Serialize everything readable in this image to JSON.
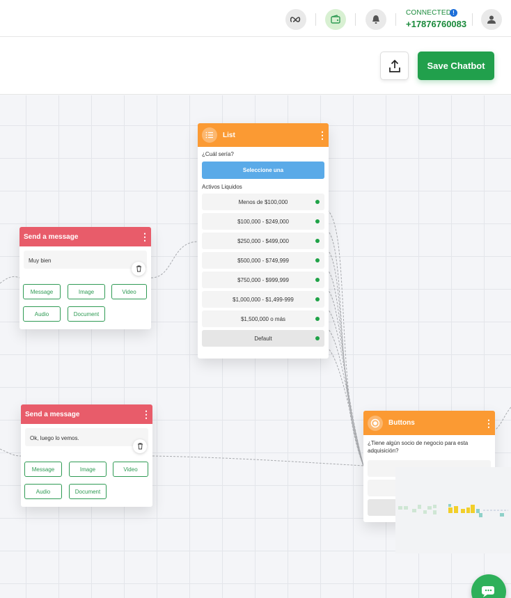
{
  "topbar": {
    "icons": [
      "meta-icon",
      "wallet-icon",
      "bell-icon",
      "user-icon"
    ],
    "connection_status": "CONNECTED",
    "info_mark": "!",
    "phone": "+17876760083"
  },
  "actions": {
    "upload_icon": "upload-icon",
    "save_label": "Save Chatbot"
  },
  "colors": {
    "brand_green": "#21a04c",
    "message_node_header": "#e85c6a",
    "list_node_header": "#fb9a33",
    "list_select": "#5aaae8"
  },
  "nodes": {
    "message1": {
      "title": "Send a message",
      "text": "Muy bien",
      "buttons": [
        "Message",
        "Image",
        "Video",
        "Audio",
        "Document"
      ]
    },
    "message2": {
      "title": "Send a message",
      "text": "Ok, luego lo vemos.",
      "buttons": [
        "Message",
        "Image",
        "Video",
        "Audio",
        "Document"
      ]
    },
    "list": {
      "title": "List",
      "question": "¿Cuál sería?",
      "select_label": "Seleccione una",
      "section_label": "Activos Liquidos",
      "rows": [
        "Menos de $100,000",
        "$100,000 - $249,000",
        "$250,000 - $499,000",
        "$500,000 - $749,999",
        "$750,000 - $999,999",
        "$1,000,000 - $1,499-999",
        "$1,500,000 o más",
        "Default"
      ]
    },
    "buttons_node": {
      "title": "Buttons",
      "question": "¿Tiene algún socio de negocio para esta adquisición?"
    }
  }
}
